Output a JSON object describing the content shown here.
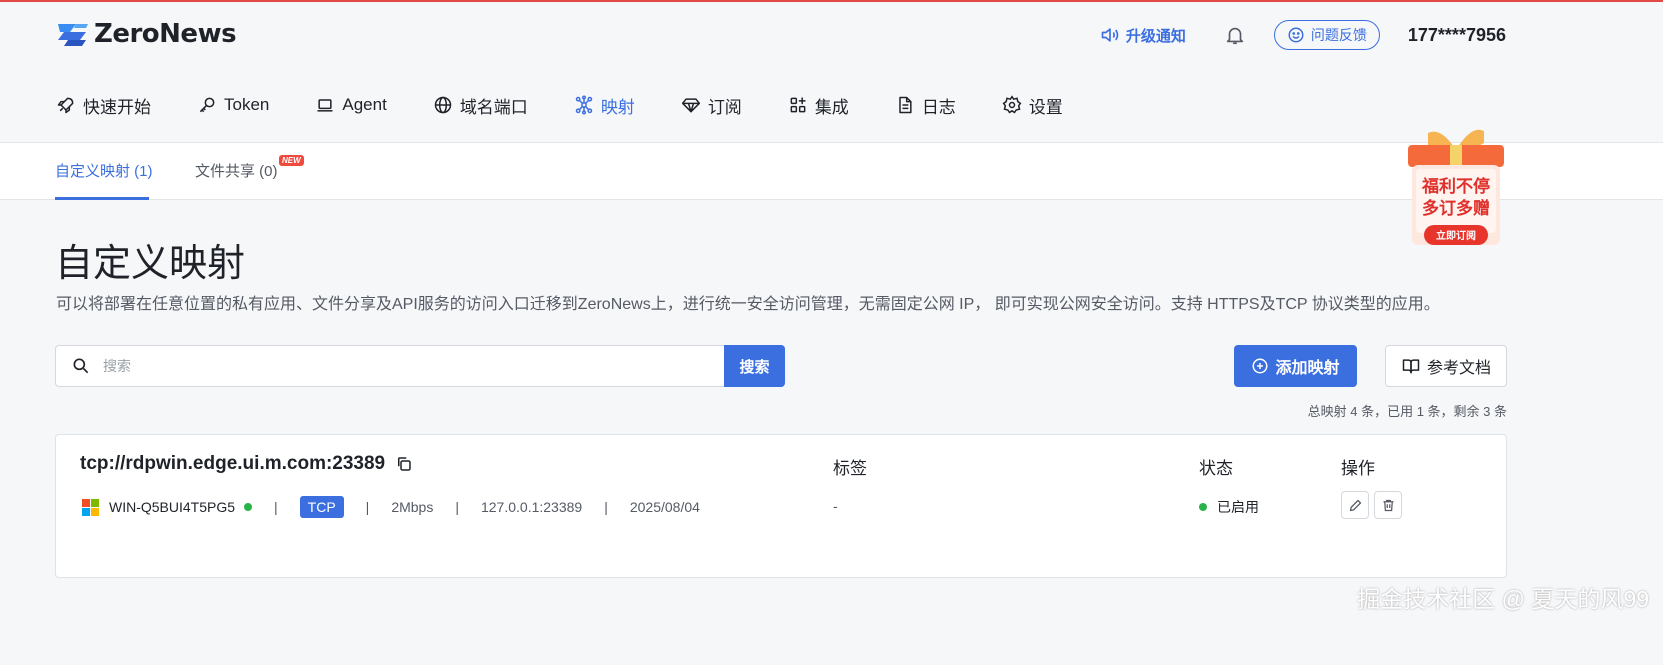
{
  "app": {
    "name": "ZeroNews"
  },
  "header": {
    "notice_label": "升级通知",
    "feedback_label": "问题反馈",
    "user_phone": "177****7956"
  },
  "nav": [
    {
      "label": "快速开始",
      "icon": "rocket-icon"
    },
    {
      "label": "Token",
      "icon": "key-icon"
    },
    {
      "label": "Agent",
      "icon": "laptop-icon"
    },
    {
      "label": "域名端口",
      "icon": "globe-icon"
    },
    {
      "label": "映射",
      "icon": "network-icon",
      "active": true
    },
    {
      "label": "订阅",
      "icon": "diamond-icon"
    },
    {
      "label": "集成",
      "icon": "apps-icon"
    },
    {
      "label": "日志",
      "icon": "document-icon"
    },
    {
      "label": "设置",
      "icon": "gear-icon"
    }
  ],
  "subtabs": [
    {
      "label": "自定义映射 (1)",
      "active": true
    },
    {
      "label": "文件共享 (0)",
      "badge": "NEW"
    }
  ],
  "promo": {
    "line1": "福利不停",
    "line2": "多订多赠",
    "cta": "立即订阅"
  },
  "page": {
    "title": "自定义映射",
    "description": "可以将部署在任意位置的私有应用、文件分享及API服务的访问入口迁移到ZeroNews上，进行统一安全访问管理，无需固定公网 IP， 即可实现公网安全访问。支持 HTTPS及TCP 协议类型的应用。"
  },
  "search": {
    "placeholder": "搜索",
    "value": "",
    "button_label": "搜索"
  },
  "actions": {
    "add_label": "添加映射",
    "docs_label": "参考文档"
  },
  "quota_text": "总映射 4 条，已用 1 条，剩余 3 条",
  "columns": {
    "tag": "标签",
    "status": "状态",
    "ops": "操作"
  },
  "mapping": {
    "address": "tcp://rdpwin.edge.ui.m.com:23389",
    "agent": "WIN-Q5BUI4T5PG5",
    "protocol": "TCP",
    "bandwidth": "2Mbps",
    "local": "127.0.0.1:23389",
    "date": "2025/08/04",
    "tag": "-",
    "status": "已启用",
    "separator": "|"
  },
  "colors": {
    "accent": "#3b6fe0",
    "status_ok": "#29b34a",
    "danger": "#f04a3e"
  },
  "watermark": "掘金技术社区 @ 夏天的风99"
}
